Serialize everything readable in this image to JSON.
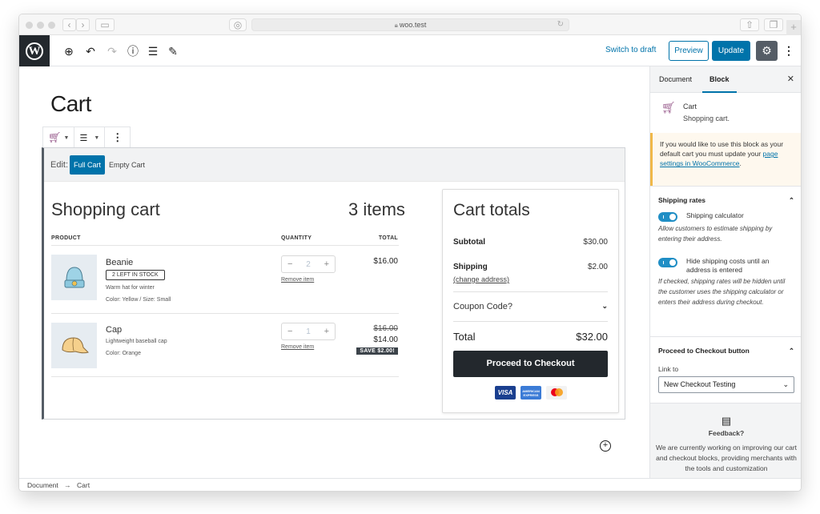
{
  "browser": {
    "url": "woo.test",
    "back_icon": "chevron-left",
    "forward_icon": "chevron-right"
  },
  "toolbar": {
    "switch_to_draft": "Switch to draft",
    "preview": "Preview",
    "update": "Update"
  },
  "page": {
    "title": "Cart"
  },
  "block": {
    "edit_label": "Edit:",
    "tabs": [
      {
        "label": "Full Cart",
        "active": true
      },
      {
        "label": "Empty Cart",
        "active": false
      }
    ]
  },
  "cart": {
    "title": "Shopping cart",
    "items_count": "3 items",
    "columns": {
      "product": "PRODUCT",
      "quantity": "QUANTITY",
      "total": "TOTAL"
    },
    "items": [
      {
        "name": "Beanie",
        "stock_badge": "2 LEFT IN STOCK",
        "description": "Warm hat for winter",
        "variation": "Color: Yellow / Size: Small",
        "quantity": "2",
        "remove": "Remove item",
        "price": "$16.00"
      },
      {
        "name": "Cap",
        "description": "Lightweight baseball cap",
        "variation": "Color: Orange",
        "quantity": "1",
        "remove": "Remove item",
        "regular_price": "$16.00",
        "price": "$14.00",
        "save_badge": "SAVE $2.00!"
      }
    ]
  },
  "totals": {
    "title": "Cart totals",
    "subtotal_label": "Subtotal",
    "subtotal": "$30.00",
    "shipping_label": "Shipping",
    "shipping": "$2.00",
    "change_address": "(change address)",
    "coupon": "Coupon Code?",
    "total_label": "Total",
    "total": "$32.00",
    "checkout": "Proceed to Checkout",
    "payment_methods": [
      "VISA",
      "American Express",
      "Mastercard"
    ]
  },
  "sidebar": {
    "tabs": [
      {
        "label": "Document",
        "active": false
      },
      {
        "label": "Block",
        "active": true
      }
    ],
    "block_name": "Cart",
    "block_description": "Shopping cart.",
    "notice_text": "If you would like to use this block as your default cart you must update your ",
    "notice_link": "page settings in WooCommerce",
    "notice_end": ".",
    "shipping_panel": {
      "title": "Shipping rates",
      "toggles": [
        {
          "label": "Shipping calculator",
          "enabled": true,
          "help": "Allow customers to estimate shipping by entering their address."
        },
        {
          "label": "Hide shipping costs until an address is entered",
          "enabled": true,
          "help": "If checked, shipping rates will be hidden until the customer uses the shipping calculator or enters their address during checkout."
        }
      ]
    },
    "checkout_panel": {
      "title": "Proceed to Checkout button",
      "link_to_label": "Link to",
      "link_to_value": "New Checkout Testing"
    },
    "feedback": {
      "title": "Feedback?",
      "text": "We are currently working on improving our cart and checkout blocks, providing merchants with the tools and customization"
    }
  },
  "footer": {
    "breadcrumb": [
      "Document",
      "Cart"
    ],
    "separator": "→"
  },
  "colors": {
    "accent": "#0073aa",
    "woo_purple": "#96588a",
    "dark": "#23282d",
    "notice_border": "#f0b849"
  }
}
